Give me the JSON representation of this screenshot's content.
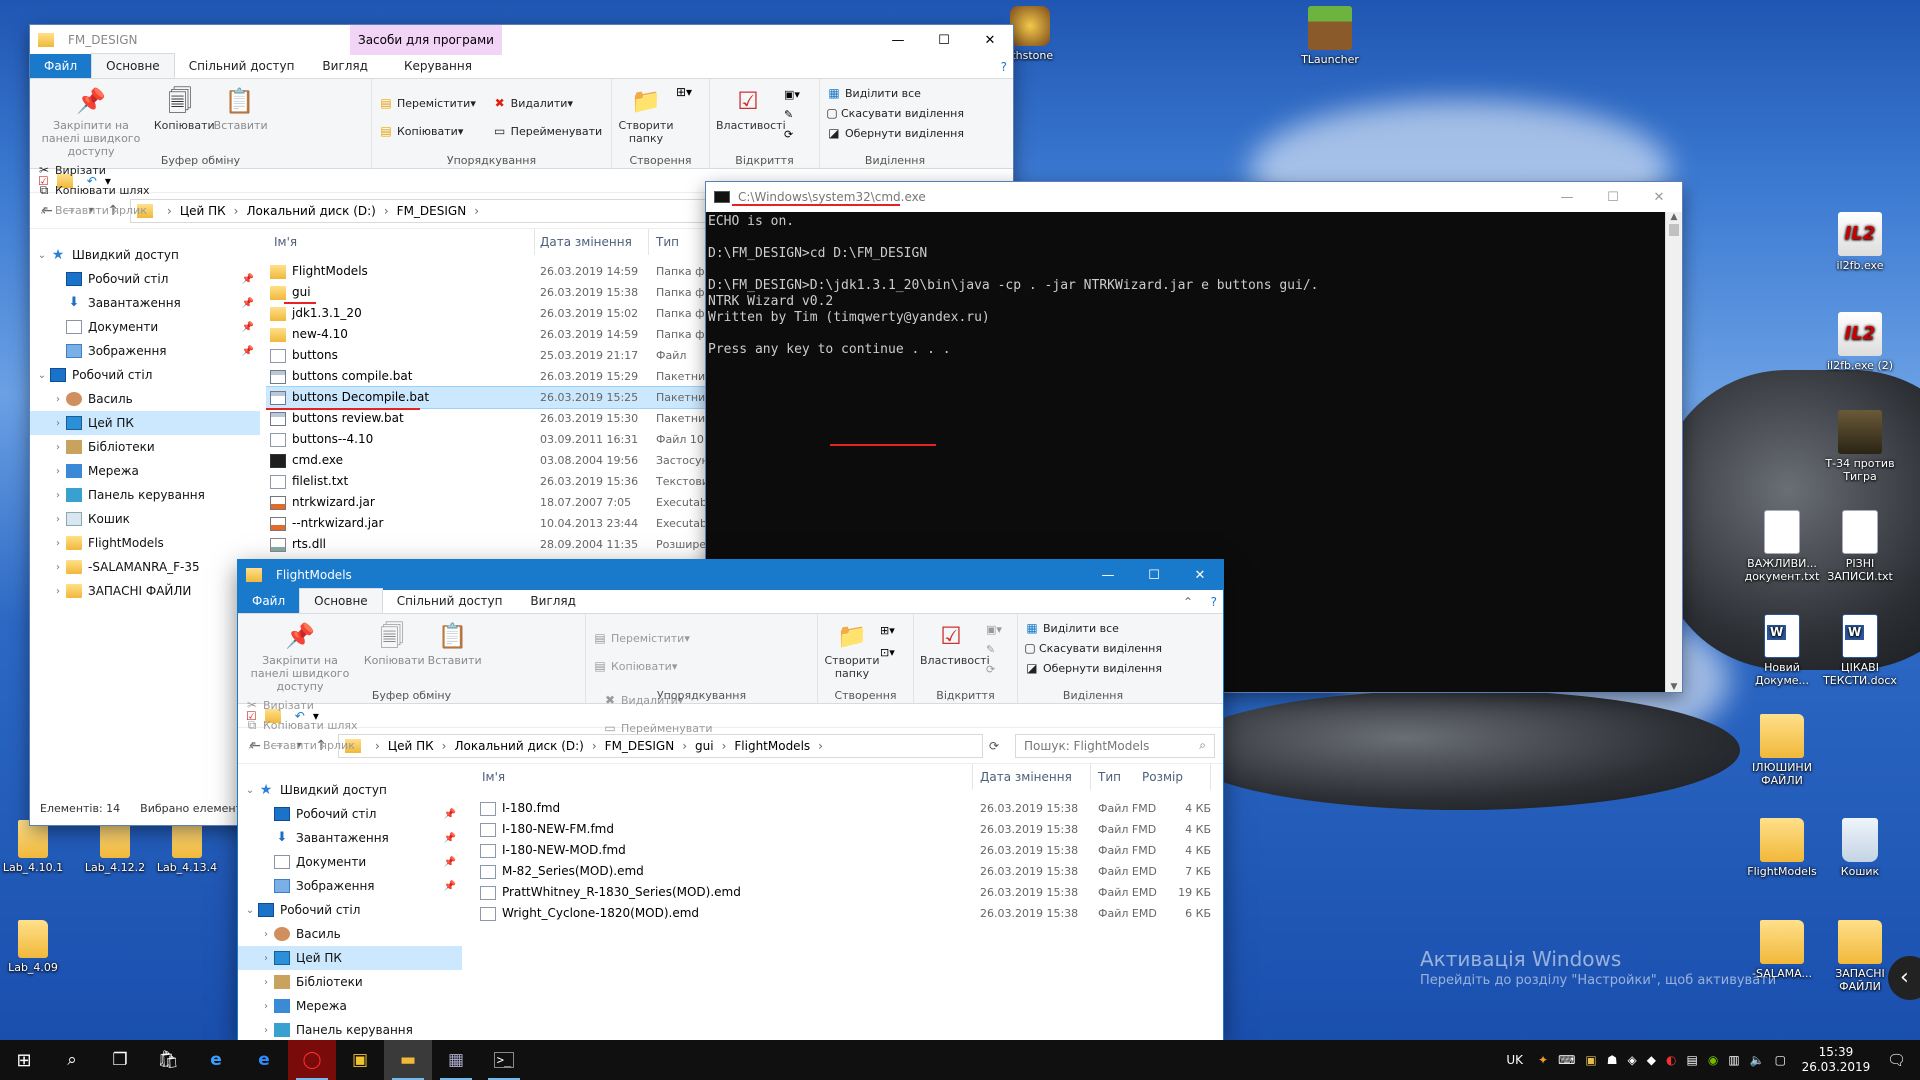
{
  "desktop": {
    "icons_left": [
      {
        "label": "Lab_4.10.1",
        "type": "folder"
      },
      {
        "label": "Lab_4.12.2",
        "type": "folder"
      },
      {
        "label": "Lab_4.13.4",
        "type": "folder"
      },
      {
        "label": "Lab_4.09",
        "type": "folder"
      }
    ],
    "icons_right": [
      {
        "label": "TLauncher",
        "type": "grass"
      },
      {
        "label": "il2fb.exe",
        "type": "il2",
        "badge": "IL2"
      },
      {
        "label": "il2fb.exe (2)",
        "type": "il2",
        "badge": "IL2"
      },
      {
        "label": "Т-34 против Тигра",
        "type": "tank"
      },
      {
        "label": "ВАЖЛИВИ... документ.txt",
        "type": "doc"
      },
      {
        "label": "РІЗНІ ЗАПИСИ.txt",
        "type": "doc"
      },
      {
        "label": "Новий Докуме...",
        "type": "word"
      },
      {
        "label": "ЦІКАВІ ТЕКСТИ.docx",
        "type": "word"
      },
      {
        "label": "ІЛЮШИНИ ФАЙЛИ",
        "type": "folder"
      },
      {
        "label": "FlightModels",
        "type": "folder"
      },
      {
        "label": "Кошик",
        "type": "bin"
      },
      {
        "label": "-SALAMA...",
        "type": "folder"
      },
      {
        "label": "ЗАПАСНІ ФАЙЛИ",
        "type": "folder"
      }
    ],
    "icons_top_partial": [
      {
        "label": "rthstone"
      }
    ],
    "watermark": {
      "title": "Активація Windows",
      "subtitle": "Перейдіть до розділу \"Настройки\", щоб активувати"
    }
  },
  "explorer_back": {
    "title": "FM_DESIGN",
    "context_tab": "Засоби для програми",
    "tabs": {
      "file": "Файл",
      "home": "Основне",
      "share": "Спільний доступ",
      "view": "Вигляд",
      "manage": "Керування"
    },
    "ribbon": {
      "pin": "Закріпити на панелі швидкого доступу",
      "copy": "Копіювати",
      "paste": "Вставити",
      "cut": "Вирізати",
      "copy_path": "Копіювати шлях",
      "paste_shortcut": "Вставити ярлик",
      "group_clipboard": "Буфер обміну",
      "move_to": "Перемістити",
      "copy_to": "Копіювати",
      "delete": "Видалити",
      "rename": "Перейменувати",
      "group_organize": "Упорядкування",
      "new_folder": "Створити папку",
      "group_new": "Створення",
      "properties": "Властивості",
      "group_open": "Відкриття",
      "select_all": "Виділити все",
      "select_none": "Скасувати виділення",
      "invert": "Обернути виділення",
      "group_select": "Виділення"
    },
    "address": [
      "Цей ПК",
      "Локальний диск (D:)",
      "FM_DESIGN"
    ],
    "nav": [
      {
        "label": "Швидкий доступ",
        "icon": "star",
        "level": 0,
        "expanded": true
      },
      {
        "label": "Робочий стіл",
        "icon": "desk",
        "level": 1,
        "pin": true
      },
      {
        "label": "Завантаження",
        "icon": "down",
        "level": 1,
        "pin": true
      },
      {
        "label": "Документи",
        "icon": "docs",
        "level": 1,
        "pin": true
      },
      {
        "label": "Зображення",
        "icon": "pics",
        "level": 1,
        "pin": true
      },
      {
        "label": "Робочий стіл",
        "icon": "desk",
        "level": 0,
        "expanded": true
      },
      {
        "label": "Василь",
        "icon": "user",
        "level": 1
      },
      {
        "label": "Цей ПК",
        "icon": "pc",
        "level": 1,
        "selected": true
      },
      {
        "label": "Бібліотеки",
        "icon": "lib",
        "level": 1
      },
      {
        "label": "Мережа",
        "icon": "net",
        "level": 1
      },
      {
        "label": "Панель керування",
        "icon": "cp",
        "level": 1
      },
      {
        "label": "Кошик",
        "icon": "bin",
        "level": 1
      },
      {
        "label": "FlightModels",
        "icon": "fold",
        "level": 1
      },
      {
        "label": "-SALAMANRA_F-35",
        "icon": "fold",
        "level": 1
      },
      {
        "label": "ЗАПАСНІ ФАЙЛИ",
        "icon": "fold",
        "level": 1
      }
    ],
    "columns": {
      "name": "Ім'я",
      "date": "Дата змінення",
      "type": "Тип"
    },
    "files": [
      {
        "name": "FlightModels",
        "date": "26.03.2019 14:59",
        "type": "Папка фа",
        "icon": "folder"
      },
      {
        "name": "gui",
        "date": "26.03.2019 15:38",
        "type": "Папка фа",
        "icon": "folder"
      },
      {
        "name": "jdk1.3.1_20",
        "date": "26.03.2019 15:02",
        "type": "Папка фа",
        "icon": "folder"
      },
      {
        "name": "new-4.10",
        "date": "26.03.2019 14:59",
        "type": "Папка фа",
        "icon": "folder"
      },
      {
        "name": "buttons",
        "date": "25.03.2019 21:17",
        "type": "Файл",
        "icon": "file"
      },
      {
        "name": "buttons compile.bat",
        "date": "26.03.2019 15:29",
        "type": "Пакетний",
        "icon": "bat"
      },
      {
        "name": "buttons Decompile.bat",
        "date": "26.03.2019 15:25",
        "type": "Пакетний",
        "icon": "bat",
        "selected": true
      },
      {
        "name": "buttons review.bat",
        "date": "26.03.2019 15:30",
        "type": "Пакетний",
        "icon": "bat"
      },
      {
        "name": "buttons--4.10",
        "date": "03.09.2011 16:31",
        "type": "Файл 10",
        "icon": "file"
      },
      {
        "name": "cmd.exe",
        "date": "03.08.2004 19:56",
        "type": "Застосун",
        "icon": "exe"
      },
      {
        "name": "filelist.txt",
        "date": "26.03.2019 15:36",
        "type": "Текстови",
        "icon": "file"
      },
      {
        "name": "ntrkwizard.jar",
        "date": "18.07.2007 7:05",
        "type": "Executabl",
        "icon": "jar"
      },
      {
        "name": "--ntrkwizard.jar",
        "date": "10.04.2013 23:44",
        "type": "Executabl",
        "icon": "jar"
      },
      {
        "name": "rts.dll",
        "date": "28.09.2004 11:35",
        "type": "Розширен",
        "icon": "dll"
      }
    ],
    "status": {
      "items": "Елементів: 14",
      "selected": "Вибрано елемент"
    }
  },
  "cmd": {
    "title": "C:\\Windows\\system32\\cmd.exe",
    "lines": [
      "ECHO is on.",
      "",
      "D:\\FM_DESIGN>cd D:\\FM_DESIGN",
      "",
      "D:\\FM_DESIGN>D:\\jdk1.3.1_20\\bin\\java -cp . -jar NTRKWizard.jar e buttons gui/.",
      "NTRK Wizard v0.2",
      "Written by Tim (timqwerty@yandex.ru)",
      "",
      "Press any key to continue . . ."
    ]
  },
  "explorer_front": {
    "title": "FlightModels",
    "tabs": {
      "file": "Файл",
      "home": "Основне",
      "share": "Спільний доступ",
      "view": "Вигляд"
    },
    "ribbon": {
      "pin": "Закріпити на панелі швидкого доступу",
      "copy": "Копіювати",
      "paste": "Вставити",
      "cut": "Вирізати",
      "copy_path": "Копіювати шлях",
      "paste_shortcut": "Вставити ярлик",
      "group_clipboard": "Буфер обміну",
      "move_to": "Перемістити",
      "copy_to": "Копіювати",
      "delete": "Видалити",
      "rename": "Перейменувати",
      "group_organize": "Упорядкування",
      "new_folder": "Створити папку",
      "group_new": "Створення",
      "properties": "Властивості",
      "group_open": "Відкриття",
      "select_all": "Виділити все",
      "select_none": "Скасувати виділення",
      "invert": "Обернути виділення",
      "group_select": "Виділення"
    },
    "address": [
      "Цей ПК",
      "Локальний диск (D:)",
      "FM_DESIGN",
      "gui",
      "FlightModels"
    ],
    "search_placeholder": "Пошук: FlightModels",
    "nav": [
      {
        "label": "Швидкий доступ",
        "icon": "star",
        "level": 0,
        "expanded": true
      },
      {
        "label": "Робочий стіл",
        "icon": "desk",
        "level": 1,
        "pin": true
      },
      {
        "label": "Завантаження",
        "icon": "down",
        "level": 1,
        "pin": true
      },
      {
        "label": "Документи",
        "icon": "docs",
        "level": 1,
        "pin": true
      },
      {
        "label": "Зображення",
        "icon": "pics",
        "level": 1,
        "pin": true
      },
      {
        "label": "Робочий стіл",
        "icon": "desk",
        "level": 0,
        "expanded": true
      },
      {
        "label": "Василь",
        "icon": "user",
        "level": 1
      },
      {
        "label": "Цей ПК",
        "icon": "pc",
        "level": 1,
        "selected": true
      },
      {
        "label": "Бібліотеки",
        "icon": "lib",
        "level": 1
      },
      {
        "label": "Мережа",
        "icon": "net",
        "level": 1
      },
      {
        "label": "Панель керування",
        "icon": "cp",
        "level": 1
      }
    ],
    "columns": {
      "name": "Ім'я",
      "date": "Дата змінення",
      "type": "Тип",
      "size": "Розмір"
    },
    "files": [
      {
        "name": "I-180.fmd",
        "date": "26.03.2019 15:38",
        "type": "Файл FMD",
        "size": "4 КБ"
      },
      {
        "name": "I-180-NEW-FM.fmd",
        "date": "26.03.2019 15:38",
        "type": "Файл FMD",
        "size": "4 КБ"
      },
      {
        "name": "I-180-NEW-MOD.fmd",
        "date": "26.03.2019 15:38",
        "type": "Файл FMD",
        "size": "4 КБ"
      },
      {
        "name": "M-82_Series(MOD).emd",
        "date": "26.03.2019 15:38",
        "type": "Файл EMD",
        "size": "7 КБ"
      },
      {
        "name": "PrattWhitney_R-1830_Series(MOD).emd",
        "date": "26.03.2019 15:38",
        "type": "Файл EMD",
        "size": "19 КБ"
      },
      {
        "name": "Wright_Cyclone-1820(MOD).emd",
        "date": "26.03.2019 15:38",
        "type": "Файл EMD",
        "size": "6 КБ"
      }
    ]
  },
  "taskbar": {
    "lang": "UK",
    "time": "15:39",
    "date": "26.03.2019"
  }
}
